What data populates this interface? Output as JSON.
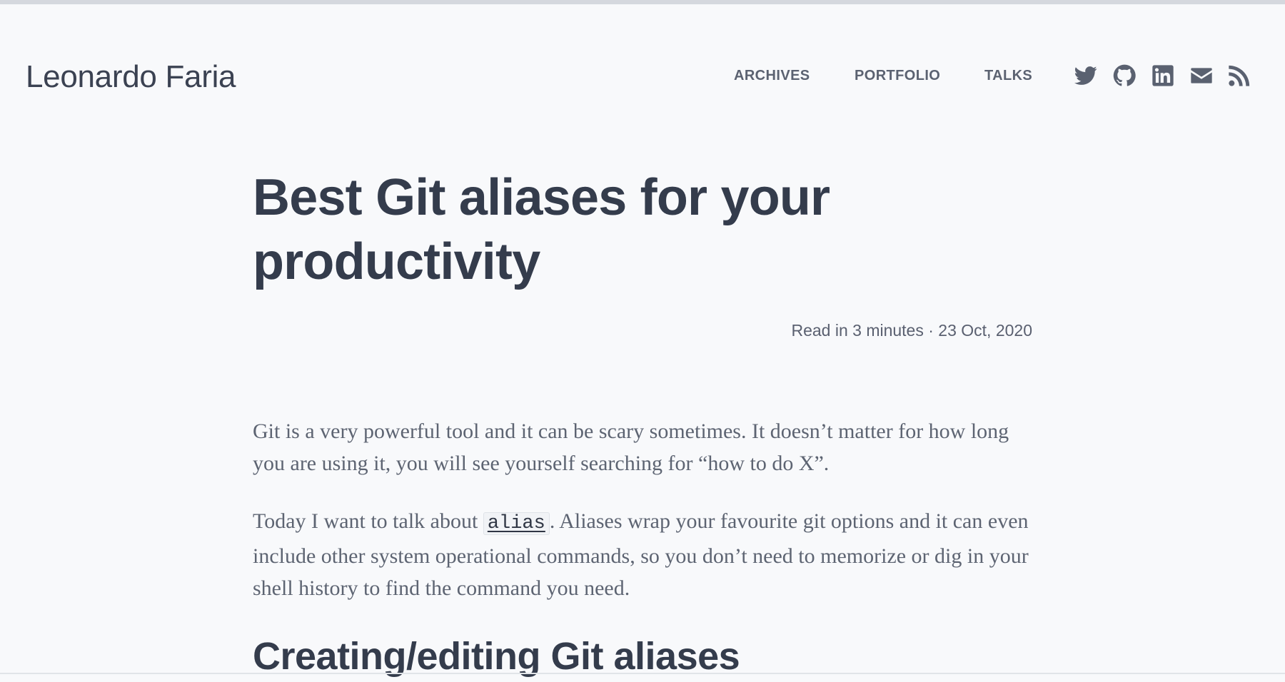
{
  "site": {
    "title": "Leonardo Faria"
  },
  "nav": {
    "items": [
      {
        "label": "ARCHIVES"
      },
      {
        "label": "PORTFOLIO"
      },
      {
        "label": "TALKS"
      }
    ]
  },
  "social": {
    "icons": [
      "twitter-icon",
      "github-icon",
      "linkedin-icon",
      "email-icon",
      "rss-icon"
    ]
  },
  "post": {
    "title": "Best Git aliases for your productivity",
    "meta": "Read in 3 minutes · 23 Oct, 2020",
    "paragraph1": "Git is a very powerful tool and it can be scary sometimes. It doesn’t matter for how long you are using it, you will see yourself searching for “how to do X”.",
    "paragraph2_before": "Today I want to talk about ",
    "paragraph2_code": "alias",
    "paragraph2_after": ". Aliases wrap your favourite git options and it can even include other system operational commands, so you don’t need to memorize or dig in your shell history to find the command you need.",
    "section_heading": "Creating/editing Git aliases"
  },
  "colors": {
    "background": "#f8f9fb",
    "heading": "#343c4c",
    "body_text": "#5d6472",
    "nav_text": "#5b6271"
  }
}
